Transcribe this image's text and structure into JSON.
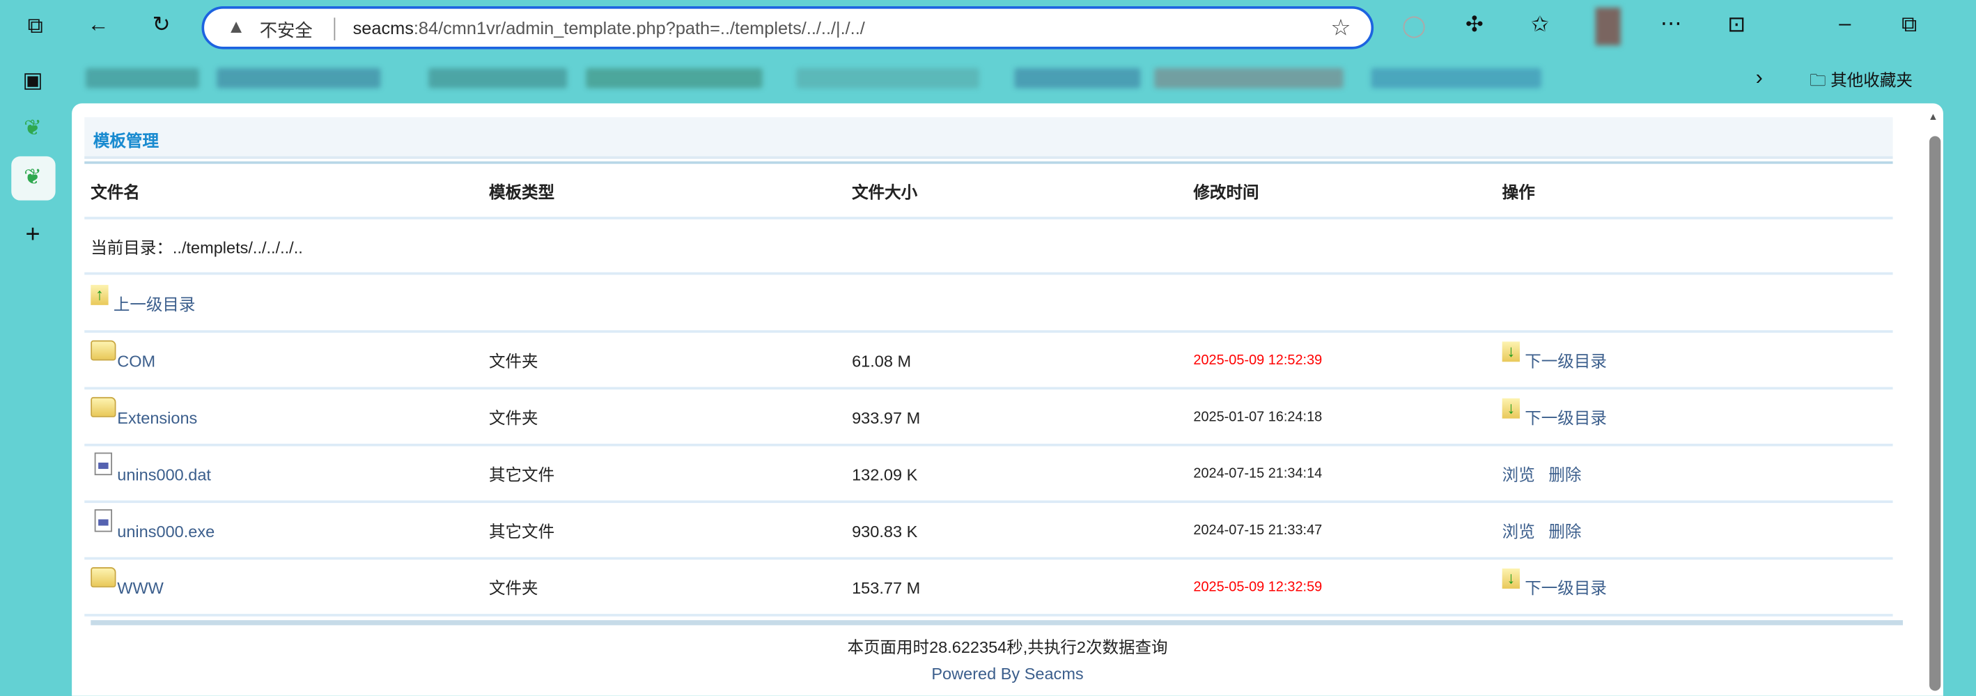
{
  "browser": {
    "address_security": "不安全",
    "url_host": "seacms",
    "url_rest": ":84/cmn1vr/admin_template.php?path=../templets/../../|./../",
    "other_bookmarks": "其他收藏夹",
    "icons": [
      "workspaces-icon",
      "back-icon",
      "refresh-icon",
      "warning-icon",
      "star-icon",
      "extensions-icon",
      "favorites-icon",
      "more-icon",
      "sidebar-icon",
      "minimize-icon",
      "maximize-icon"
    ]
  },
  "page": {
    "title": "模板管理",
    "headers": [
      "文件名",
      "模板类型",
      "文件大小",
      "修改时间",
      "操作"
    ],
    "current_dir_label": "当前目录：../templets/../../../..",
    "parent_dir": "上一级目录",
    "rows": [
      {
        "name": "COM",
        "type": "文件夹",
        "size": "61.08 M",
        "time": "2025-05-09 12:52:39",
        "recent": true,
        "kind": "folder",
        "actions": [
          "下一级目录"
        ]
      },
      {
        "name": "Extensions",
        "type": "文件夹",
        "size": "933.97 M",
        "time": "2025-01-07 16:24:18",
        "recent": false,
        "kind": "folder",
        "actions": [
          "下一级目录"
        ]
      },
      {
        "name": "unins000.dat",
        "type": "其它文件",
        "size": "132.09 K",
        "time": "2024-07-15 21:34:14",
        "recent": false,
        "kind": "file",
        "actions": [
          "浏览",
          "删除"
        ]
      },
      {
        "name": "unins000.exe",
        "type": "其它文件",
        "size": "930.83 K",
        "time": "2024-07-15 21:33:47",
        "recent": false,
        "kind": "file",
        "actions": [
          "浏览",
          "删除"
        ]
      },
      {
        "name": "WWW",
        "type": "文件夹",
        "size": "153.77 M",
        "time": "2025-05-09 12:32:59",
        "recent": true,
        "kind": "folder",
        "actions": [
          "下一级目录"
        ]
      }
    ],
    "footer_stats": "本页面用时28.622354秒,共执行2次数据查询",
    "powered_by": "Powered By Seacms"
  },
  "colors": {
    "background": "#63d1d3",
    "accent": "#1a8bd0",
    "link": "#3b5e8c",
    "recent_time": "#ff0000"
  }
}
